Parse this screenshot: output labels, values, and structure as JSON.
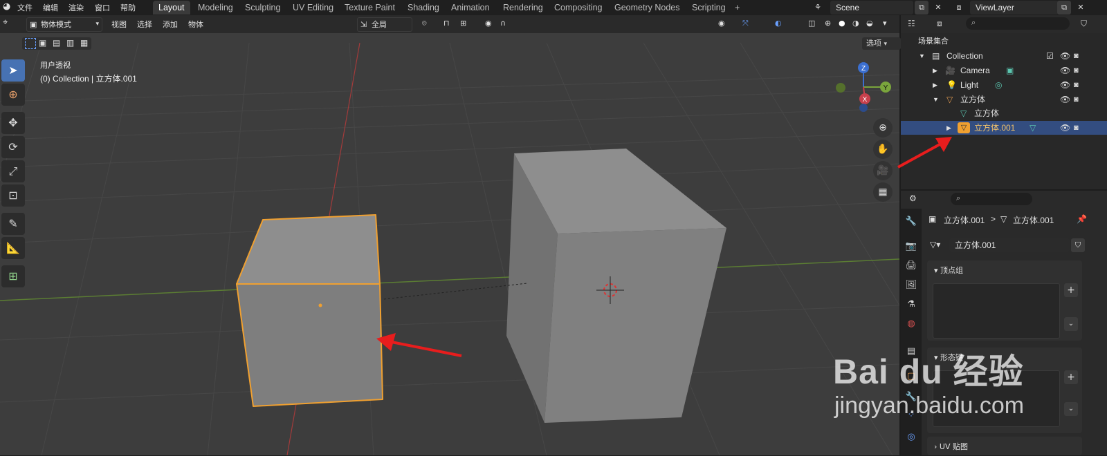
{
  "menu": {
    "file": "文件",
    "edit": "编辑",
    "render": "渲染",
    "window": "窗口",
    "help": "帮助"
  },
  "workspaces": [
    "Layout",
    "Modeling",
    "Sculpting",
    "UV Editing",
    "Texture Paint",
    "Shading",
    "Animation",
    "Rendering",
    "Compositing",
    "Geometry Nodes",
    "Scripting"
  ],
  "active_workspace": "Layout",
  "add_workspace": "+",
  "scene": {
    "name": "Scene"
  },
  "view_layer": {
    "name": "ViewLayer"
  },
  "viewport_header": {
    "mode": "物体模式",
    "view": "视图",
    "select": "选择",
    "add": "添加",
    "object": "物体",
    "transform_orientation": "全局",
    "options": "选项"
  },
  "viewport": {
    "view_name": "用户透视",
    "context": "(0) Collection | 立方体.001",
    "gizmo": {
      "x": "X",
      "y": "Y",
      "z": "Z"
    },
    "colors": {
      "x_axis": "#c8404c",
      "y_axis": "#7aa53c",
      "selected_outline": "#f0a030",
      "arrow": "#e81d1d"
    }
  },
  "outliner": {
    "root": "场景集合",
    "rows": [
      {
        "label": "Collection",
        "icon": "collection-icon"
      },
      {
        "label": "Camera",
        "icon": "camera-object-icon"
      },
      {
        "label": "Light",
        "icon": "light-object-icon"
      },
      {
        "label": "立方体",
        "icon": "mesh-object-icon"
      },
      {
        "label": "立方体",
        "icon": "mesh-data-icon"
      },
      {
        "label": "立方体.001",
        "icon": "mesh-object-icon",
        "selected": true
      }
    ]
  },
  "properties": {
    "breadcrumb_object": "立方体.001",
    "breadcrumb_sep": ">",
    "breadcrumb_data": "立方体.001",
    "mesh_name": "立方体.001",
    "panels": {
      "vertex_groups": "顶点组",
      "shape_keys": "形态键",
      "uv_maps": "UV 贴图"
    }
  },
  "watermark": {
    "brand": "Bai du 经验",
    "url": "jingyan.baidu.com"
  }
}
